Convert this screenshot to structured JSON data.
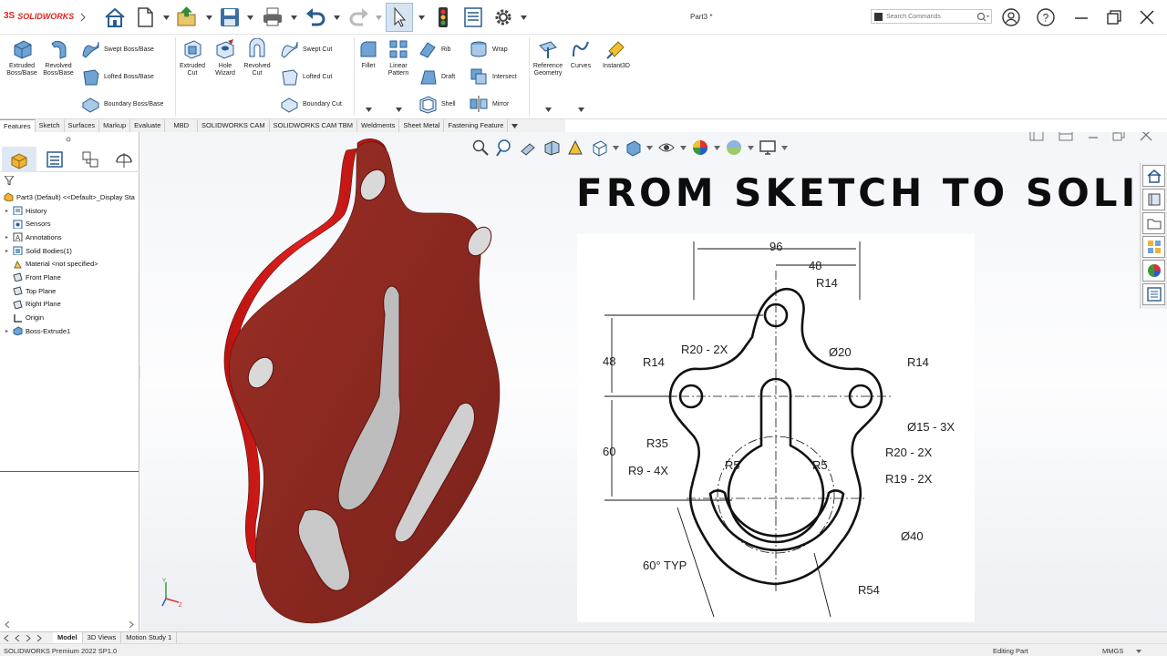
{
  "app": {
    "brand": "SOLIDWORKS",
    "document_title": "Part3 *",
    "search_placeholder": "Search Commands"
  },
  "ribbon": {
    "extruded_boss": [
      "Extruded",
      "Boss/Base"
    ],
    "revolved_boss": [
      "Revolved",
      "Boss/Base"
    ],
    "swept_boss": "Swept Boss/Base",
    "lofted_boss": "Lofted Boss/Base",
    "boundary_boss": "Boundary Boss/Base",
    "extruded_cut": [
      "Extruded",
      "Cut"
    ],
    "hole_wizard": [
      "Hole",
      "Wizard"
    ],
    "revolved_cut": [
      "Revolved",
      "Cut"
    ],
    "swept_cut": "Swept Cut",
    "lofted_cut": "Lofted Cut",
    "boundary_cut": "Boundary Cut",
    "fillet": "Fillet",
    "linear_pattern": [
      "Linear",
      "Pattern"
    ],
    "rib": "Rib",
    "draft": "Draft",
    "shell": "Shell",
    "wrap": "Wrap",
    "intersect": "Intersect",
    "mirror": "Mirror",
    "reference_geometry": [
      "Reference",
      "Geometry"
    ],
    "curves": "Curves",
    "instant3d": "Instant3D"
  },
  "command_tabs": [
    "Features",
    "Sketch",
    "Surfaces",
    "Markup",
    "Evaluate",
    "MBD",
    "SOLIDWORKS CAM",
    "SOLIDWORKS CAM TBM",
    "Weldments",
    "Sheet Metal",
    "Fastening Feature"
  ],
  "feature_tree": {
    "root": "Part3 (Default) <<Default>_Display Sta",
    "items": [
      "History",
      "Sensors",
      "Annotations",
      "Solid Bodies(1)",
      "Material <not specified>",
      "Front Plane",
      "Top Plane",
      "Right Plane",
      "Origin",
      "Boss-Extrude1"
    ]
  },
  "overlay": {
    "headline": "FROM SKETCH TO SOLID"
  },
  "drawing": {
    "dim_96": "96",
    "dim_48_top": "48",
    "r14_top": "R14",
    "r20_2x_left": "R20 - 2X",
    "dia20": "Ø20",
    "r14_left": "R14",
    "r14_right": "R14",
    "dim_48_left": "48",
    "dia15_3x": "Ø15 - 3X",
    "r35": "R35",
    "r20_2x_right": "R20 - 2X",
    "dim_60": "60",
    "r5_left": "R5",
    "r5_right": "R5",
    "r9_4x": "R9 - 4X",
    "r19_2x": "R19 - 2X",
    "dia40": "Ø40",
    "angle_60": "60° TYP",
    "r54": "R54"
  },
  "bottom_tabs": [
    "Model",
    "3D Views",
    "Motion Study 1"
  ],
  "status": {
    "version": "SOLIDWORKS Premium 2022 SP1.0",
    "mode": "Editing Part",
    "units": "MMGS"
  },
  "colors": {
    "part_face": "#8c2a22",
    "part_edge": "#cf1c1a",
    "solidworks_red": "#d6261f",
    "tree_accent": "#1f6fb5"
  },
  "icons": [
    "home-icon",
    "new-document-icon",
    "open-icon",
    "save-icon",
    "print-icon",
    "undo-icon",
    "redo-icon",
    "select-arrow-icon",
    "traffic-light-icon",
    "file-properties-icon",
    "options-gear-icon",
    "user-icon",
    "help-icon"
  ]
}
